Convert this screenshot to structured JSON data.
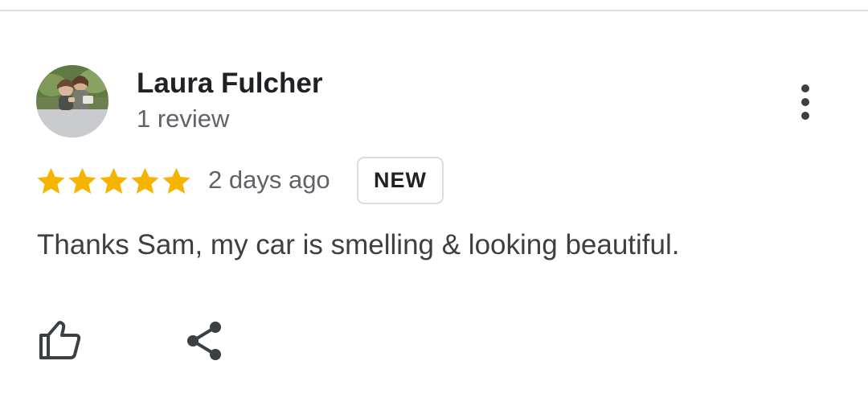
{
  "review": {
    "reviewer_name": "Laura Fulcher",
    "review_count": "1 review",
    "rating": 5,
    "rating_max": 5,
    "time_ago": "2 days ago",
    "badge": "NEW",
    "text": "Thanks Sam, my car is smelling & looking beautiful."
  },
  "colors": {
    "star": "#f4b400",
    "name": "#202124",
    "secondary_text": "#5f6368",
    "body_text": "#3c4043",
    "badge_border": "#dadce0"
  },
  "icons": {
    "more": "more-vert-icon",
    "like": "thumb-up-icon",
    "share": "share-icon",
    "star": "star-icon"
  }
}
